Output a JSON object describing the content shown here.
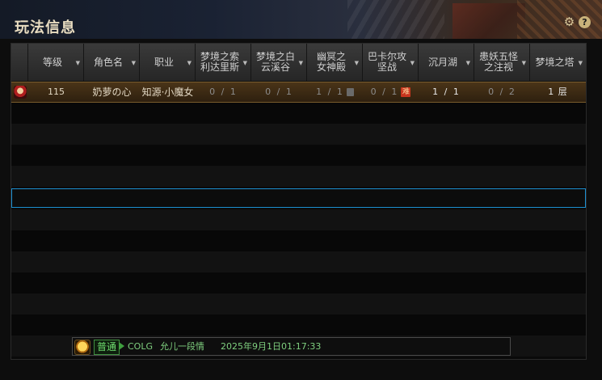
{
  "window": {
    "title": "玩法信息"
  },
  "columns": [
    {
      "label": "等级"
    },
    {
      "label": "角色名"
    },
    {
      "label": "职业"
    },
    {
      "label": "梦境之索利达里斯"
    },
    {
      "label": "梦境之白云溪谷"
    },
    {
      "label": "幽冥之女神殿"
    },
    {
      "label": "巴卡尔攻坚战"
    },
    {
      "label": "沉月湖"
    },
    {
      "label": "患妖五怪之注视"
    },
    {
      "label": "梦境之塔"
    }
  ],
  "character": {
    "level": "115",
    "name": "奶萝の心",
    "class": "知源·小魔女",
    "solidaris": "0 / 1",
    "baiyun": "0 / 1",
    "goddess": "1 / 1",
    "bakal": "0 / 1",
    "bakal_badge": "难",
    "moonlake": "1 / 1",
    "five_demons": "0 / 2",
    "tower": "1 层"
  },
  "chat": {
    "channel": "普通",
    "source": "COLG",
    "user": "允儿一段情",
    "time": "2025年9月1日01:17:33"
  },
  "icons": {
    "settings": "gear-icon",
    "help": "help-icon",
    "lock": "lock-icon",
    "avatar": "avatar-icon"
  },
  "colors": {
    "selection_border": "#1c8fd0",
    "chat_green": "#6fdc6f"
  }
}
